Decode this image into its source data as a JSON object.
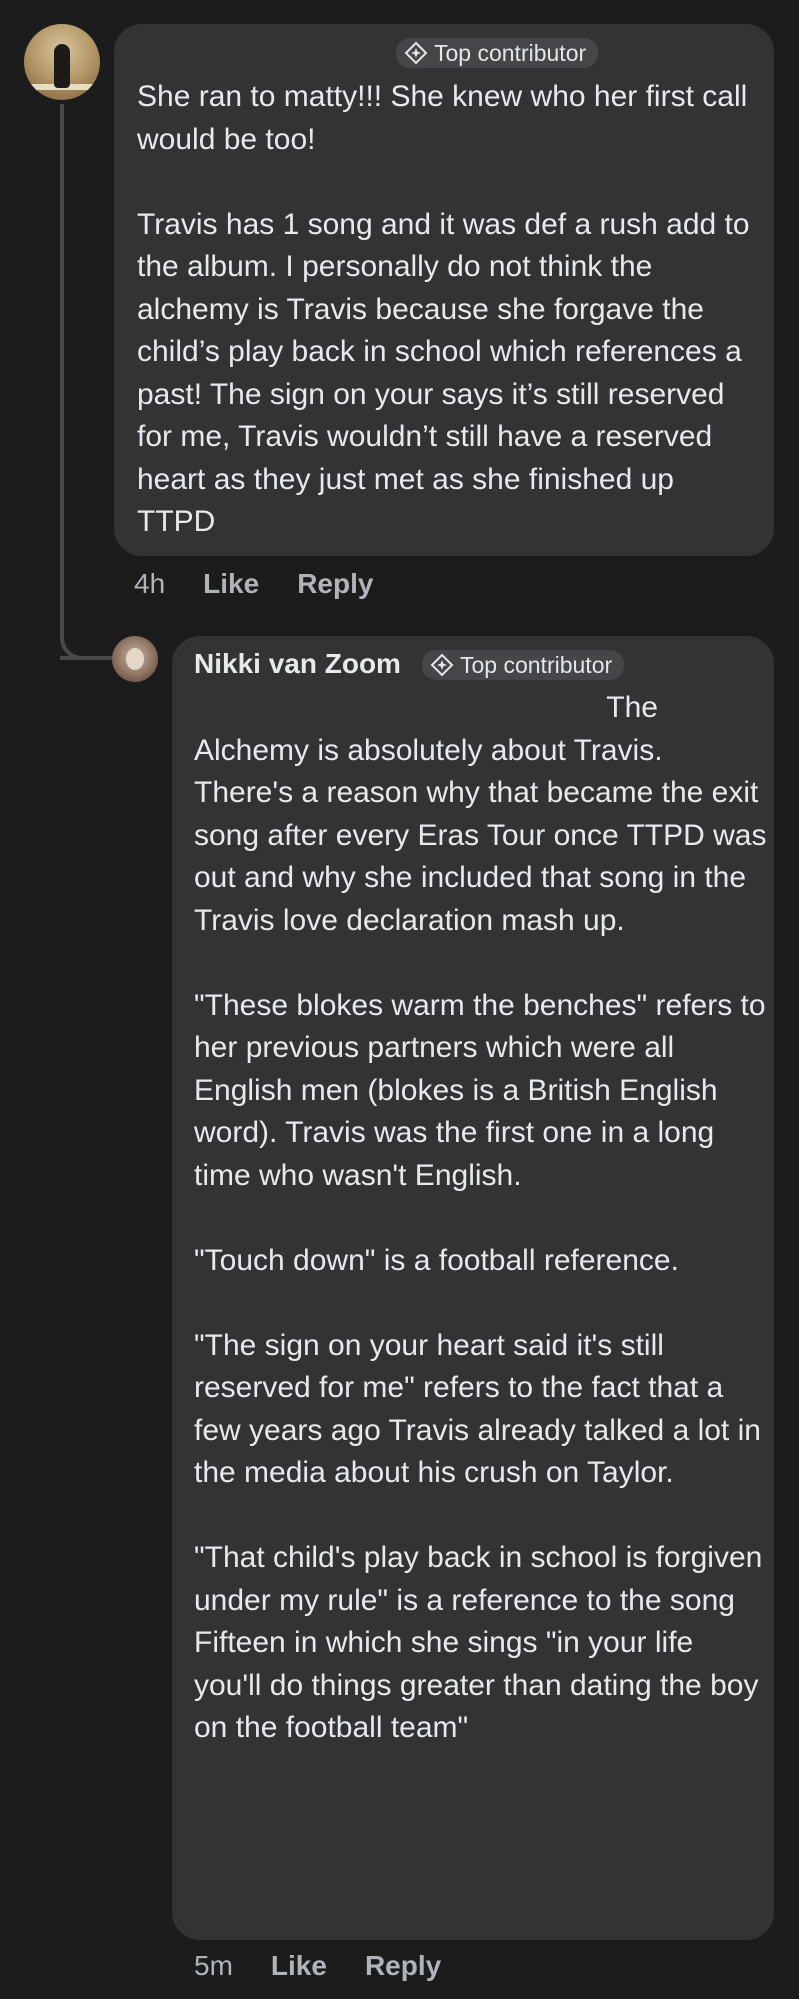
{
  "comments": [
    {
      "badge": "Top contributor",
      "text": "She ran to matty!!! She knew who her first call would be too!\n\nTravis has 1 song and it was def a rush add to the album. I personally do not think the alchemy is Travis because she forgave the child’s play back in school which references a past! The sign on your says it’s still reserved for me, Travis wouldn’t still have a reserved heart as they just met as she finished up TTPD",
      "time": "4h",
      "like_label": "Like",
      "reply_label": "Reply"
    }
  ],
  "reply": {
    "author": "Nikki van Zoom",
    "badge": "Top contributor",
    "text_first_line": "The",
    "text": "Alchemy is absolutely about Travis. There's a reason why that became the exit song after every Eras Tour once TTPD was out and why she included that song in the Travis love declaration mash up.\n\n\"These blokes warm the benches\" refers to her previous partners which were all English men (blokes is a British English word). Travis was the first one in a long time who wasn't English.\n\n\"Touch down\" is a football reference.\n\n\"The sign on your heart said it's still reserved for me\" refers to the fact that a few years ago Travis already talked a lot in the media about his crush on Taylor.\n\n\"That child's play back in school is forgiven under my rule\" is a reference to the song Fifteen in which she sings \"in your life you'll do things greater than dating the boy on the football team\"",
    "time": "5m",
    "like_label": "Like",
    "reply_label": "Reply"
  },
  "colors": {
    "background": "#1c1c1c",
    "bubble": "#333334",
    "badge": "#464648",
    "text": "#e8e9ec",
    "meta": "#b0b3b8"
  },
  "icons": {
    "badge_icon": "top-contributor-diamond-icon"
  }
}
